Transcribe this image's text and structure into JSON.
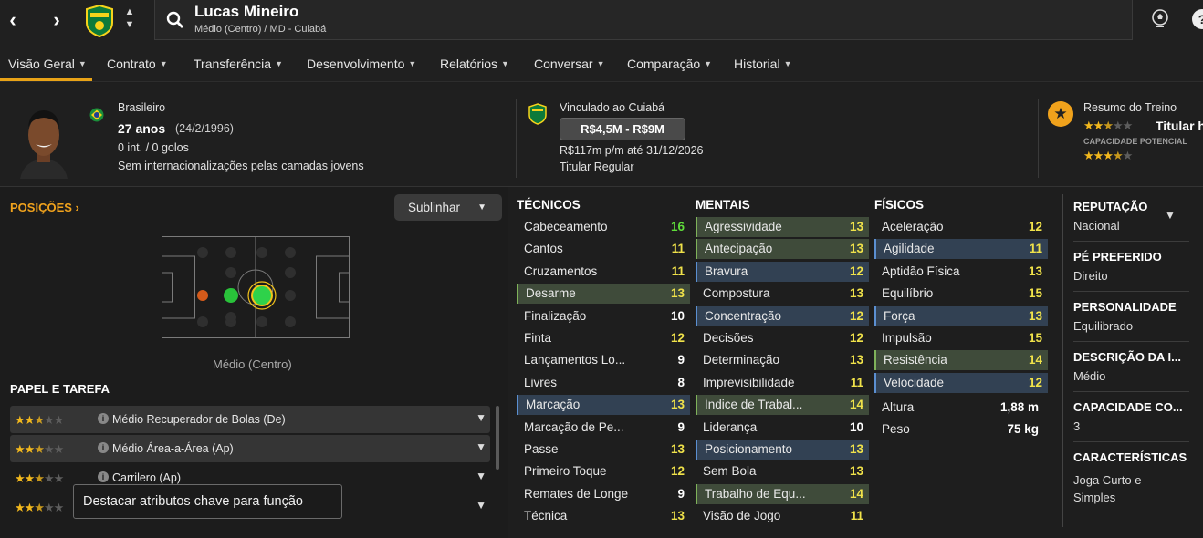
{
  "player": {
    "name": "Lucas Mineiro",
    "subtitle": "Médio (Centro) / MD - Cuiabá"
  },
  "tabs": [
    {
      "label": "Visão Geral"
    },
    {
      "label": "Contrato"
    },
    {
      "label": "Transferência"
    },
    {
      "label": "Desenvolvimento"
    },
    {
      "label": "Relatórios"
    },
    {
      "label": "Conversar"
    },
    {
      "label": "Comparação"
    },
    {
      "label": "Historial"
    }
  ],
  "info": {
    "nationality": "Brasileiro",
    "age": "27 anos",
    "dob": "(24/2/1996)",
    "caps": "0 int. / 0 golos",
    "youth_caps": "Sem internacionalizações pelas camadas jovens",
    "contract_club": "Vinculado ao Cuiabá",
    "value_range": "R$4,5M - R$9M",
    "wage": "R$117m p/m até 31/12/2026",
    "squad_status": "Titular Regular",
    "training_title": "Resumo do Treino",
    "training_role": "Titular h",
    "potential_label": "CAPACIDADE POTENCIAL",
    "current_stars": 2.5,
    "potential_stars": 3.5
  },
  "positions": {
    "title": "POSIÇÕES",
    "highlight_button": "Sublinhar",
    "position_label": "Médio (Centro)"
  },
  "roles": {
    "title": "PAPEL E TAREFA",
    "items": [
      {
        "name": "Médio Recuperador de Bolas (De)",
        "stars": 2.5
      },
      {
        "name": "Médio Área-a-Área (Ap)",
        "stars": 2.5
      },
      {
        "name": "Carrilero (Ap)",
        "stars": 2.5
      },
      {
        "name": "",
        "stars": 2.5
      }
    ],
    "tooltip": "Destacar atributos chave para função"
  },
  "attributes": {
    "technical": {
      "title": "TÉCNICOS",
      "items": [
        {
          "name": "Cabeceamento",
          "value": "16",
          "hl": ""
        },
        {
          "name": "Cantos",
          "value": "11",
          "hl": ""
        },
        {
          "name": "Cruzamentos",
          "value": "11",
          "hl": ""
        },
        {
          "name": "Desarme",
          "value": "13",
          "hl": "g"
        },
        {
          "name": "Finalização",
          "value": "10",
          "hl": ""
        },
        {
          "name": "Finta",
          "value": "12",
          "hl": ""
        },
        {
          "name": "Lançamentos Lo...",
          "value": "9",
          "hl": ""
        },
        {
          "name": "Livres",
          "value": "8",
          "hl": ""
        },
        {
          "name": "Marcação",
          "value": "13",
          "hl": "b"
        },
        {
          "name": "Marcação de Pe...",
          "value": "9",
          "hl": ""
        },
        {
          "name": "Passe",
          "value": "13",
          "hl": ""
        },
        {
          "name": "Primeiro Toque",
          "value": "12",
          "hl": ""
        },
        {
          "name": "Remates de Longe",
          "value": "9",
          "hl": ""
        },
        {
          "name": "Técnica",
          "value": "13",
          "hl": ""
        }
      ]
    },
    "mental": {
      "title": "MENTAIS",
      "items": [
        {
          "name": "Agressividade",
          "value": "13",
          "hl": "g"
        },
        {
          "name": "Antecipação",
          "value": "13",
          "hl": "g"
        },
        {
          "name": "Bravura",
          "value": "12",
          "hl": "b"
        },
        {
          "name": "Compostura",
          "value": "13",
          "hl": ""
        },
        {
          "name": "Concentração",
          "value": "12",
          "hl": "b"
        },
        {
          "name": "Decisões",
          "value": "12",
          "hl": ""
        },
        {
          "name": "Determinação",
          "value": "13",
          "hl": ""
        },
        {
          "name": "Imprevisibilidade",
          "value": "11",
          "hl": ""
        },
        {
          "name": "Índice de Trabal...",
          "value": "14",
          "hl": "g"
        },
        {
          "name": "Liderança",
          "value": "10",
          "hl": ""
        },
        {
          "name": "Posicionamento",
          "value": "13",
          "hl": "b"
        },
        {
          "name": "Sem Bola",
          "value": "13",
          "hl": ""
        },
        {
          "name": "Trabalho de Equ...",
          "value": "14",
          "hl": "g"
        },
        {
          "name": "Visão de Jogo",
          "value": "11",
          "hl": ""
        }
      ]
    },
    "physical": {
      "title": "FÍSICOS",
      "items": [
        {
          "name": "Aceleração",
          "value": "12",
          "hl": ""
        },
        {
          "name": "Agilidade",
          "value": "11",
          "hl": "b"
        },
        {
          "name": "Aptidão Física",
          "value": "13",
          "hl": ""
        },
        {
          "name": "Equilíbrio",
          "value": "15",
          "hl": ""
        },
        {
          "name": "Força",
          "value": "13",
          "hl": "b"
        },
        {
          "name": "Impulsão",
          "value": "15",
          "hl": ""
        },
        {
          "name": "Resistência",
          "value": "14",
          "hl": "g"
        },
        {
          "name": "Velocidade",
          "value": "12",
          "hl": "b"
        }
      ],
      "height_label": "Altura",
      "height_value": "1,88 m",
      "weight_label": "Peso",
      "weight_value": "75 kg"
    }
  },
  "side": {
    "reputation_title": "REPUTAÇÃO",
    "reputation_value": "Nacional",
    "foot_title": "PÉ PREFERIDO",
    "foot_value": "Direito",
    "personality_title": "PERSONALIDADE",
    "personality_value": "Equilibrado",
    "media_title": "DESCRIÇÃO DA I...",
    "media_value": "Médio",
    "ability_title": "CAPACIDADE CO...",
    "ability_value": "3",
    "traits_title": "CARACTERÍSTICAS",
    "traits_value_1": "Joga Curto e",
    "traits_value_2": "Simples"
  },
  "colors": {
    "accent": "#e8a317",
    "highlight_green": "#3f4b3a",
    "highlight_blue": "#324153"
  }
}
